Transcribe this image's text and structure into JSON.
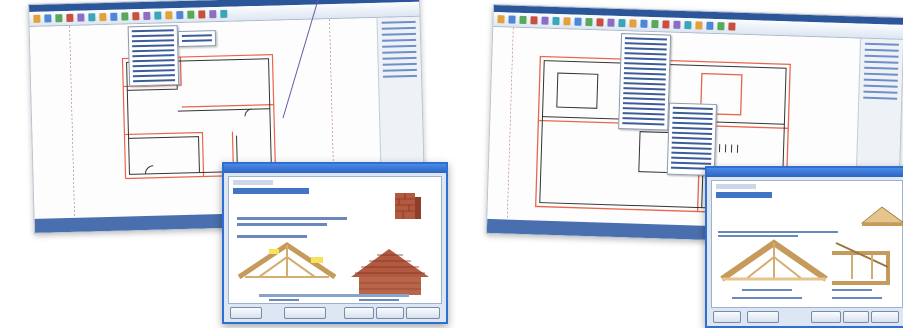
{
  "screenshots": [
    {
      "id": "left",
      "app_window": {
        "ribbon_icons": 18,
        "has_side_panel": true
      },
      "dialog": {
        "caption": "",
        "buttons": [
          "",
          "",
          "",
          "",
          ""
        ]
      }
    },
    {
      "id": "right",
      "app_window": {
        "ribbon_icons": 22,
        "has_side_panel": true
      },
      "dialog": {
        "caption": "",
        "buttons": [
          "",
          "",
          "",
          "",
          ""
        ]
      }
    }
  ],
  "colors": {
    "title_bar": "#2b579a",
    "status_bar": "#4a6fae",
    "wall_outline": "#e8664a",
    "dialog_border": "#2f6fd1",
    "roof_wood": "#e6c58c",
    "brick": "#b3593f"
  },
  "icons": {
    "ribbon": "toolbar-icon",
    "brick_sample": "brick-icon",
    "roof_preview": "roof-icon"
  }
}
